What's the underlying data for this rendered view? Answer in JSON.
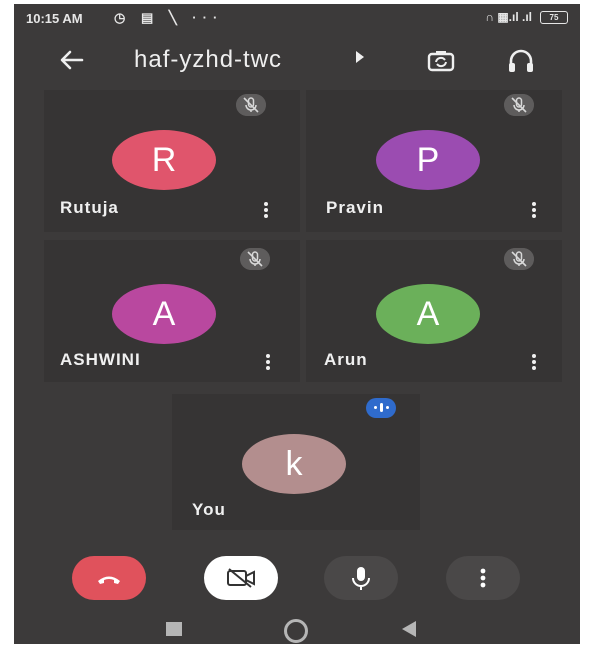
{
  "status_bar": {
    "time": "10:15 AM",
    "left_icons": "◷ ▤ ╲ ···",
    "right_icons": "∩ ▦.ıl .ıl",
    "battery": "75"
  },
  "header": {
    "title": "haf-yzhd-twc"
  },
  "participants": [
    {
      "name": "Rutuja",
      "initial": "R",
      "color": "#e0556c",
      "muted": true
    },
    {
      "name": "Pravin",
      "initial": "P",
      "color": "#9b4cb1",
      "muted": true
    },
    {
      "name": "ASHWINI",
      "initial": "A",
      "color": "#b9489f",
      "muted": true
    },
    {
      "name": "Arun",
      "initial": "A",
      "color": "#6bb05a",
      "muted": true
    }
  ],
  "self": {
    "name": "You",
    "initial": "k",
    "color": "#b38e8e",
    "speaking": true
  },
  "controls": {
    "end_call_color": "#e0525c",
    "camera_off_color": "#ffffff",
    "mic_color": "#4a4848",
    "more_color": "#4a4848"
  },
  "icons": {
    "back": "arrow-left",
    "camera_switch": "camera-switch",
    "audio": "headphones",
    "mute": "mic-off",
    "end_call": "phone-hangup",
    "camera": "video-off",
    "mic": "mic",
    "more": "more-vertical"
  }
}
